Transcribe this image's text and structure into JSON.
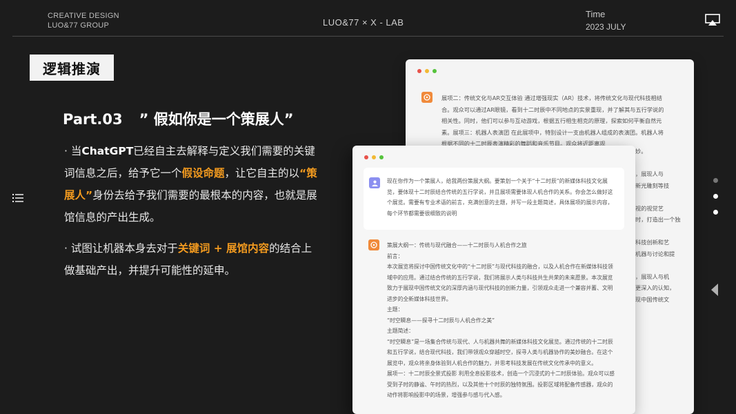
{
  "header": {
    "brand_line1": "CREATIVE DESIGN",
    "brand_line2": "LUO&77 GROUP",
    "center": "LUO&77 ×  X - LAB",
    "time_label": "Time",
    "time_value": "2023 JULY"
  },
  "section_tag": "逻辑推演",
  "part": {
    "number": "Part.03",
    "title": "” 假如你是一个策展人”"
  },
  "bullet1": {
    "p1": "· 当",
    "p2": "ChatGPT",
    "p3": "已经自主去解释与定义我们需要的关键词信息之后，给予它一个",
    "hl1": "假设命题",
    "p4": "，让它自主的以",
    "hl2": "“策展人”",
    "p5": "身份去给予我们需要的最根本的内容，也就是展馆信息的产出生成。"
  },
  "bullet2": {
    "p1": "· 试图让机器本身去对于",
    "hl1": "关键词 + 展馆内容",
    "p2": "的结合上做基础产出，并提升可能性的延申。"
  },
  "back_window": {
    "text": "展项二：传统文化与AR交互体验 通过增强现实（AR）技术，将传统文化与现代科技相结合。观众可以通过AR眼镜，看到十二时辰中不同地点的实景重现，并了解其与五行学说的相关性。同时，他们可以参与互动游戏，根据五行相生相克的原理，探索如何平衡自然元素。展项三：机器人表演团 在此展项中，特别设计一支由机器人组成的表演团。机器人将根据不同的十二时辰表演精彩的舞蹈和音乐节目。观众将近距离观",
    "right_fragments": [
      "妙。",
      "",
      "，展现人与",
      "新光雕刻等技",
      "",
      "视的视觉艺",
      "时，打造出一个独",
      "",
      "科技创新和艺",
      "机器与讨论和提",
      "",
      "，展现人与机",
      "更深入的认知，",
      "现中国传统文"
    ]
  },
  "front_window": {
    "user_prompt": "现在你作为一个策展人，给我两份策展大纲。要策划一个关于“十二时辰”的新媒体科技文化展览，要体现十二时辰结合传统的五行学说，并且展项需要体现人机合作的关系。你会怎么做好这个展览。需要有专业术语的前言，充满创意的主题，并写一段主题简述，具体展项的展示内容，每个环节都需要很细致的说明",
    "answer": [
      "策展大纲一：传统与现代融合——十二时辰与人机合作之旅",
      "前言：",
      "本次展览将探讨中国传统文化中的“十二时辰”与现代科技的融合，以及人机合作在新媒体科技领域中的应用。通过结合传统的五行学说，我们将展示人类与科技共生共荣的未来愿景。本次展览致力于展现中国传统文化的深厚内涵与现代科技的创新力量，引领观众走进一个兼容并蓄、文明进步的全新媒体科技世界。",
      "主题：",
      "“时空瞬息——探寻十二时辰与人机合作之美”",
      "主题简述：",
      "“时空瞬息”是一场集合传统与现代、人与机器共舞的新媒体科技文化展览。通过传统的十二时辰和五行学说，结合现代科技，我们带领观众穿越时空，探寻人类与机器协作的美妙融合。在这个展览中，观众将亲身体验到人机合作的魅力，并思考科技发展在传统文化传承中的意义。",
      "展项一：十二时辰全景式投影 利用全息投影技术，创造一个沉浸式的十二时辰体验。观众可以感受到子时的静谧、午时的热烈，以及其他十个时辰的独特氛围。投影区域将配备传感器，观众的动作将影响投影中的场景，增强参与感与代入感。"
    ]
  },
  "colors": {
    "background": "#1c1c1c",
    "accent": "#f29a1f",
    "tag_bg": "#f2f2f2"
  }
}
